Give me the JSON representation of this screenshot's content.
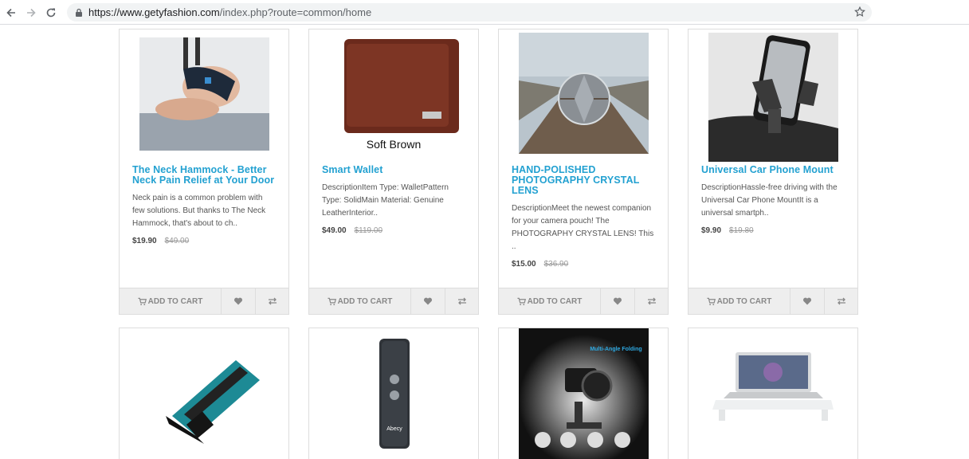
{
  "browser": {
    "url_host": "https://www.getyfashion.com",
    "url_path": "/index.php?route=common/home",
    "icons": [
      "back-arrow-icon",
      "forward-arrow-icon",
      "reload-icon",
      "lock-icon",
      "bookmark-star-icon"
    ]
  },
  "products": [
    {
      "title": "The Neck Hammock - Better Neck Pain Relief at Your Door",
      "description": "Neck pain is a common problem with few solutions. But thanks to The Neck Hammock, that's about to ch..",
      "price": "$19.90",
      "old_price": "$49.00",
      "add_to_cart": "ADD TO CART"
    },
    {
      "title": "Smart Wallet",
      "image_caption": "Soft Brown",
      "description": "DescriptionItem Type: WalletPattern Type: SolidMain Material: Genuine LeatherInterior..",
      "price": "$49.00",
      "old_price": "$119.00",
      "add_to_cart": "ADD TO CART"
    },
    {
      "title": "HAND-POLISHED PHOTOGRAPHY CRYSTAL LENS",
      "description": "DescriptionMeet the newest companion for your camera pouch! The PHOTOGRAPHY CRYSTAL LENS! This ..",
      "price": "$15.00",
      "old_price": "$36.90",
      "add_to_cart": "ADD TO CART"
    },
    {
      "title": "Universal Car Phone Mount",
      "description": "DescriptionHassle-free driving with the Universal Car Phone MountIt is a universal smartph..",
      "price": "$9.90",
      "old_price": "$19.80",
      "add_to_cart": "ADD TO CART"
    }
  ],
  "row2": [
    {
      "image": "contour-gauge"
    },
    {
      "image": "translator-device",
      "image_text": "Abecy"
    },
    {
      "image": "camera-stand",
      "image_text": "Multi-Angle Folding"
    },
    {
      "image": "laptop-stand"
    }
  ],
  "colors": {
    "title_link": "#23a1d1",
    "button_bg": "#eeeeee",
    "border": "#dddddd"
  }
}
